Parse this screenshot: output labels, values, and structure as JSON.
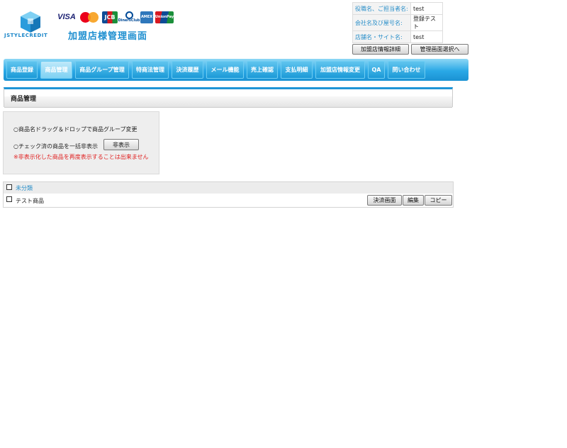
{
  "header": {
    "logo_text": "JSTYLECREDIT",
    "title": "加盟店様管理画面",
    "cards": {
      "visa": "VISA",
      "jcb": "JCB",
      "diners": "DinersClub",
      "amex": "AMEX",
      "unionpay": "UnionPay"
    },
    "info": [
      {
        "label": "役職名、ご担当者名:",
        "value": "test"
      },
      {
        "label": "会社名及び屋号名:",
        "value": "登録テスト"
      },
      {
        "label": "店舗名・サイト名:",
        "value": "test"
      }
    ],
    "buttons": {
      "store_detail": "加盟店情報詳細",
      "select_screen": "管理画面選択へ"
    }
  },
  "nav": {
    "tabs": [
      "商品登録",
      "商品管理",
      "商品グループ管理",
      "特商法管理",
      "決済履歴",
      "メール機能",
      "売上確認",
      "支払明細",
      "加盟店情報変更",
      "QA",
      "問い合わせ"
    ],
    "active_index": 1
  },
  "section": {
    "title": "商品管理"
  },
  "panel": {
    "line1": "○商品名ドラッグ＆ドロップで商品グループ変更",
    "line2": "○チェック済の商品を一括非表示",
    "hide_button": "非表示",
    "warning": "※非表示化した商品を再度表示することは出来ません"
  },
  "products": {
    "group_name": "未分類",
    "items": [
      {
        "name": "テスト商品",
        "btn_checkout": "決済画面",
        "btn_edit": "編集",
        "btn_copy": "コピー"
      }
    ]
  },
  "colors": {
    "accent": "#1f95d6",
    "nav": "#2aa8e6",
    "warning": "#e02020",
    "link": "#2a8fc9"
  }
}
